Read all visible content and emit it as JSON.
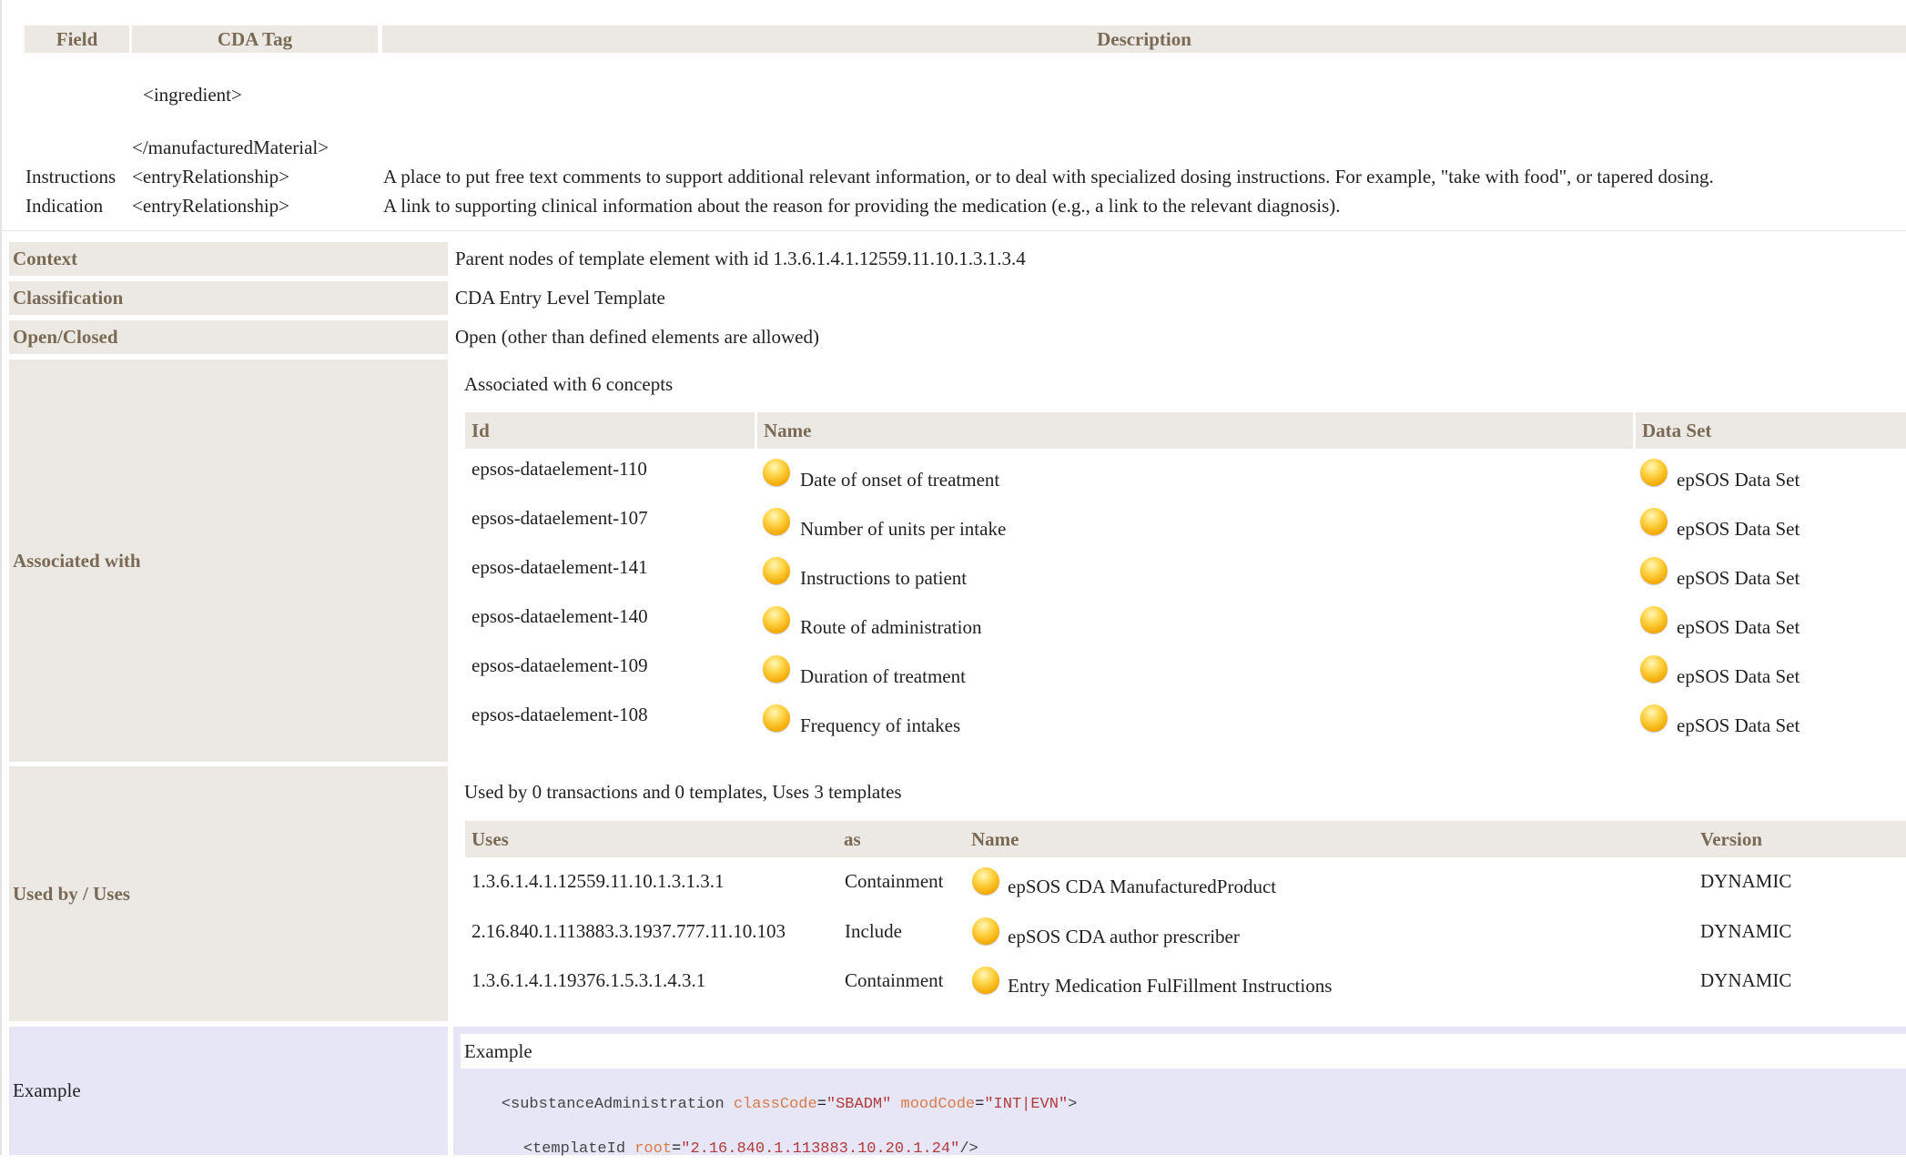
{
  "field_table": {
    "headers": [
      "Field",
      "CDA Tag",
      "Description"
    ],
    "ingredient": "<ingredient>",
    "manufactured_material_close": "</manufacturedMaterial>",
    "rows": [
      {
        "field": "Instructions",
        "tag": "<entryRelationship>",
        "description": "A place to put free text comments to support additional relevant information, or to deal with specialized dosing instructions. For example, \"take with food\", or tapered dosing."
      },
      {
        "field": "Indication",
        "tag": "<entryRelationship>",
        "description": "A link to supporting clinical information about the reason for providing the medication (e.g., a link to the relevant diagnosis)."
      }
    ]
  },
  "context": {
    "label": "Context",
    "value": "Parent nodes of template element with id 1.3.6.1.4.1.12559.11.10.1.3.1.3.4"
  },
  "classification": {
    "label": "Classification",
    "value": "CDA Entry Level Template"
  },
  "open_closed": {
    "label": "Open/Closed",
    "value": "Open (other than defined elements are allowed)"
  },
  "associated": {
    "label": "Associated with",
    "summary": "Associated with 6 concepts",
    "headers": [
      "Id",
      "Name",
      "Data Set"
    ],
    "rows": [
      {
        "id": "epsos-dataelement-110",
        "name": "Date of onset of treatment",
        "dataset": "epSOS Data Set"
      },
      {
        "id": "epsos-dataelement-107",
        "name": "Number of units per intake",
        "dataset": "epSOS Data Set"
      },
      {
        "id": "epsos-dataelement-141",
        "name": "Instructions to patient",
        "dataset": "epSOS Data Set"
      },
      {
        "id": "epsos-dataelement-140",
        "name": "Route of administration",
        "dataset": "epSOS Data Set"
      },
      {
        "id": "epsos-dataelement-109",
        "name": "Duration of treatment",
        "dataset": "epSOS Data Set"
      },
      {
        "id": "epsos-dataelement-108",
        "name": "Frequency of intakes",
        "dataset": "epSOS Data Set"
      }
    ]
  },
  "used_by": {
    "label": "Used by / Uses",
    "summary": "Used by 0 transactions and 0 templates, Uses 3 templates",
    "headers": [
      "Uses",
      "as",
      "Name",
      "Version"
    ],
    "rows": [
      {
        "uses": "1.3.6.1.4.1.12559.11.10.1.3.1.3.1",
        "as": "Containment",
        "name": "epSOS CDA ManufacturedProduct",
        "version": "DYNAMIC"
      },
      {
        "uses": "2.16.840.1.113883.3.1937.777.11.10.103",
        "as": "Include",
        "name": "epSOS CDA author prescriber",
        "version": "DYNAMIC"
      },
      {
        "uses": "1.3.6.1.4.1.19376.1.5.3.1.4.3.1",
        "as": "Containment",
        "name": "Entry Medication FulFillment Instructions",
        "version": "DYNAMIC"
      }
    ]
  },
  "example": {
    "label": "Example",
    "box_title": "Example",
    "line1": {
      "open": "<substanceAdministration",
      "attr1": "classCode",
      "val1": "\"SBADM\"",
      "attr2": "moodCode",
      "val2": "\"INT|EVN\"",
      "close": ">"
    },
    "line2": {
      "open": "<templateId",
      "attr1": "root",
      "val1": "\"2.16.840.1.113883.10.20.1.24\"",
      "close": "/>"
    }
  },
  "colors": {
    "header_bg": "#ece9e4",
    "header_text": "#7a6a55",
    "example_bg": "#e6e6f7",
    "concept_icon": "#f2a800"
  }
}
